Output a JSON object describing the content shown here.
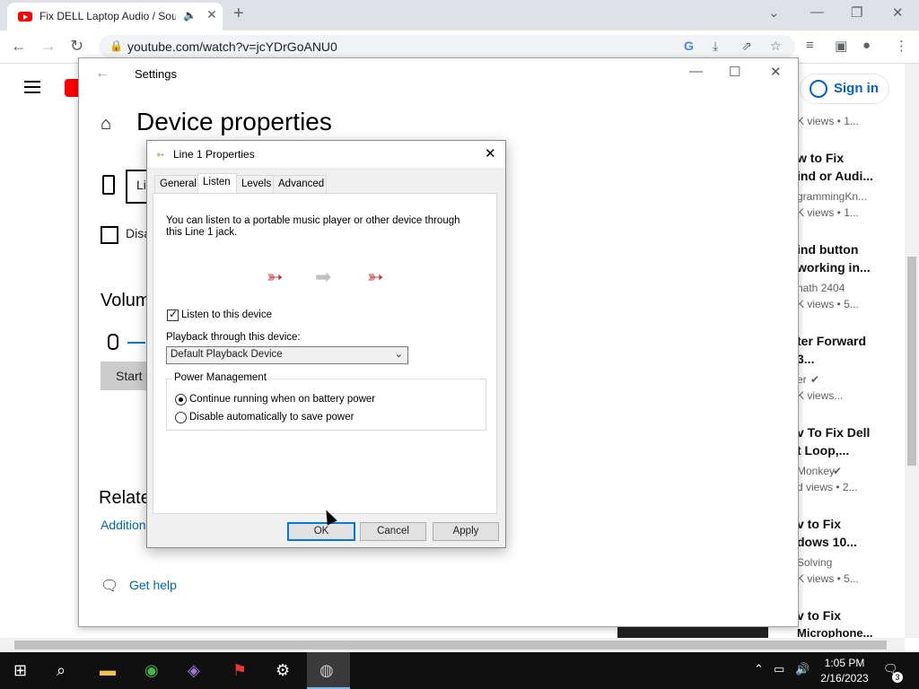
{
  "browser": {
    "tab_title": "Fix DELL Laptop Audio / Sou",
    "url": "youtube.com/watch?v=jcYDrGoANU0"
  },
  "youtube": {
    "sign_in": "Sign in",
    "videos": [
      {
        "title1": "",
        "title2": "",
        "channel": "",
        "meta": "K views  •  1..."
      },
      {
        "title1": "w to Fix",
        "title2": "ind or Audi...",
        "channel": "grammingKn...",
        "meta": "K views  •  1..."
      },
      {
        "title1": "ind button",
        "title2": "working in...",
        "channel": "nath 2404",
        "meta": "K views  •  5..."
      },
      {
        "title1": "ter Forward",
        "title2": "3...",
        "channel": "er",
        "meta": "K views..."
      },
      {
        "title1": "v To Fix Dell",
        "title2": "t Loop,...",
        "channel": "Monkey",
        "meta": "d views  •  2..."
      },
      {
        "title1": "v to Fix",
        "title2": "dows 10...",
        "channel": "Solving",
        "meta": "K views  •  5..."
      },
      {
        "title1": "v to Fix",
        "title2": "Microphone...",
        "channel": "",
        "meta": ""
      }
    ]
  },
  "settings": {
    "window_title": "Settings",
    "heading": "Device properties",
    "device_name_partial": "Li",
    "disable_label": "Disa",
    "volume_heading": "Volum",
    "start_button": "Start t",
    "related_heading": "Relate",
    "additional_link": "Addition",
    "get_help": "Get help"
  },
  "dialog": {
    "title": "Line 1 Properties",
    "tabs": [
      "General",
      "Listen",
      "Levels",
      "Advanced"
    ],
    "active_tab": "Listen",
    "description_line1": "You can listen to a portable music player or other device through",
    "description_line2": "this Line 1 jack.",
    "listen_checkbox_label": "Listen to this device",
    "listen_checked": true,
    "playback_label": "Playback through this device:",
    "playback_value": "Default Playback Device",
    "power_group_label": "Power Management",
    "radio_continue": "Continue running when on battery power",
    "radio_disable": "Disable automatically to save power",
    "selected_radio": "continue",
    "buttons": {
      "ok": "OK",
      "cancel": "Cancel",
      "apply": "Apply"
    }
  },
  "taskbar": {
    "time": "1:05 PM",
    "date": "2/16/2023",
    "notification_count": "3"
  },
  "colors": {
    "youtube_red": "#ff0000",
    "link_blue": "#0067b8",
    "accent": "#0078d7"
  }
}
